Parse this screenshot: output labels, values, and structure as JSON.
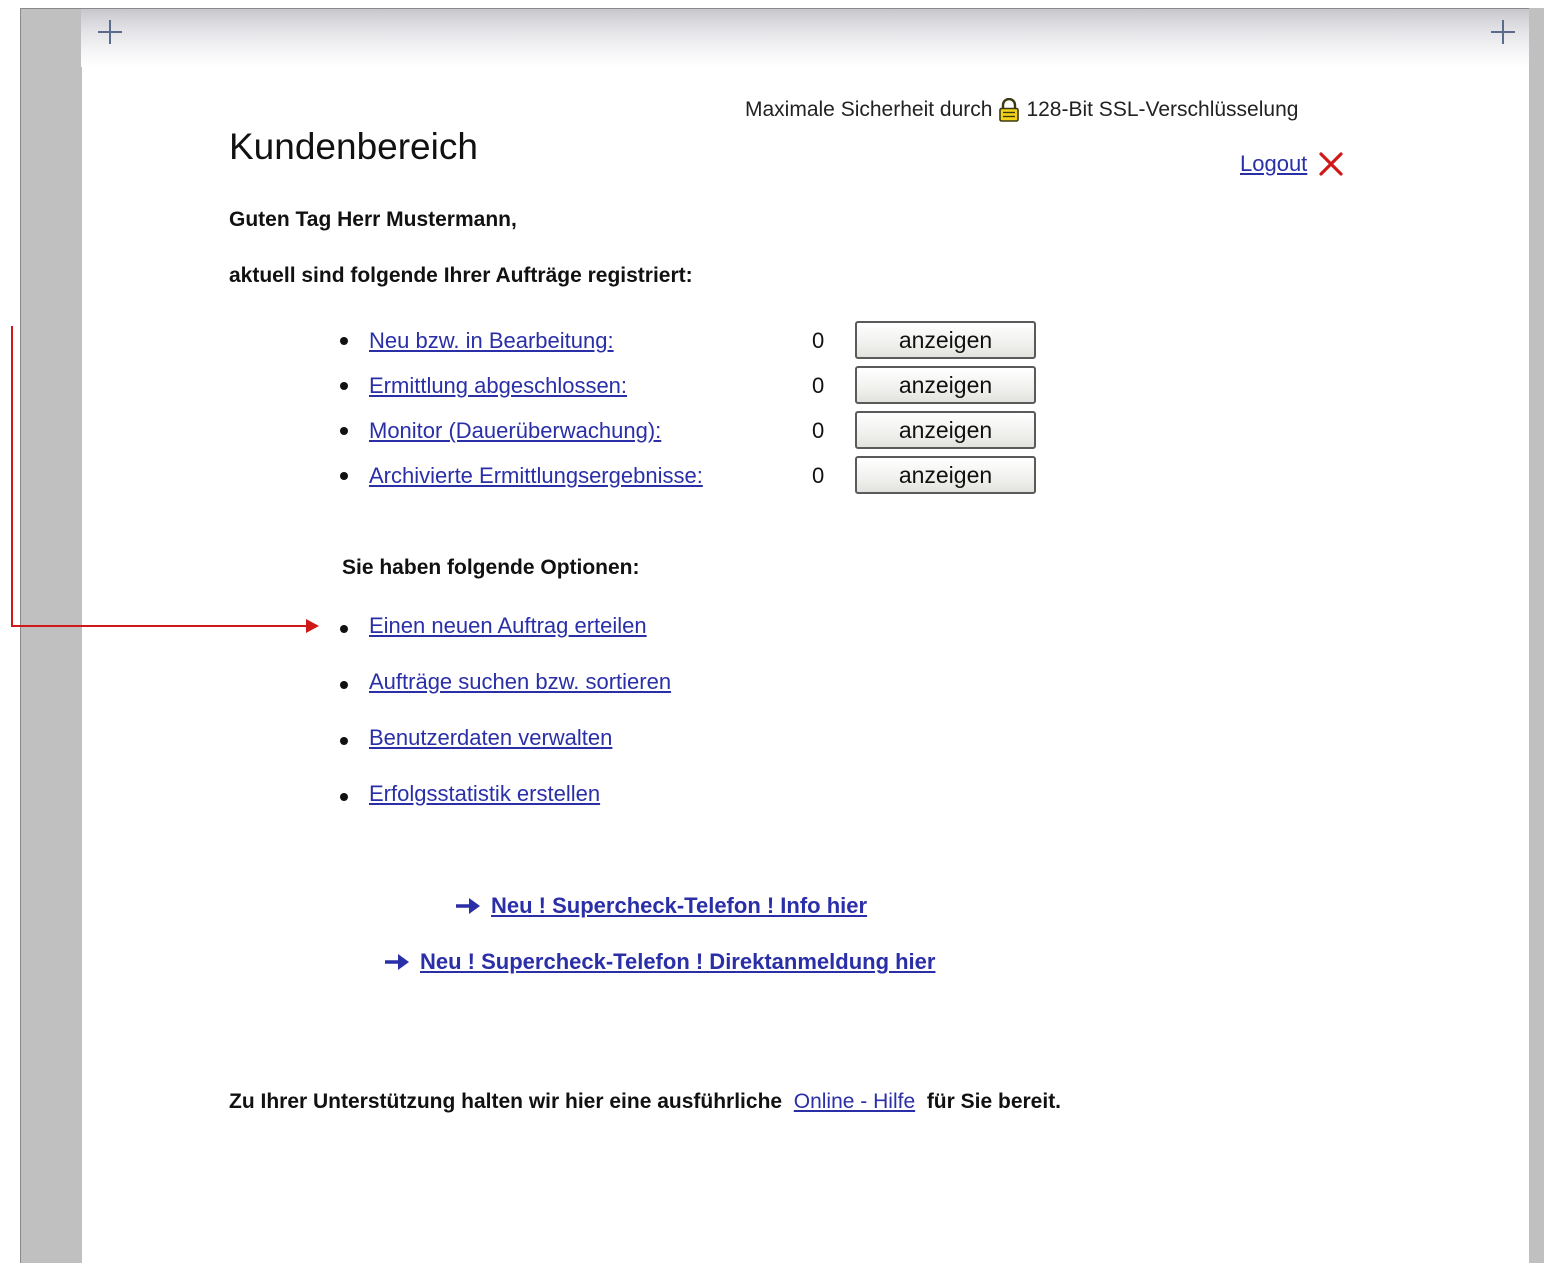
{
  "header": {
    "security_text_before": "Maximale Sicherheit durch",
    "security_text_after": "128-Bit SSL-Verschlüsselung",
    "logout_label": "Logout"
  },
  "page": {
    "title": "Kundenbereich",
    "greeting": "Guten Tag Herr Mustermann,",
    "orders_intro": "aktuell sind folgende Ihrer Aufträge registriert:"
  },
  "orders": [
    {
      "label": "Neu bzw. in Bearbeitung:",
      "count": "0",
      "button": "anzeigen"
    },
    {
      "label": "Ermittlung abgeschlossen:",
      "count": "0",
      "button": "anzeigen"
    },
    {
      "label": "Monitor (Dauerüberwachung):",
      "count": "0",
      "button": "anzeigen"
    },
    {
      "label": "Archivierte Ermittlungsergebnisse:",
      "count": "0",
      "button": "anzeigen"
    }
  ],
  "options": {
    "heading": "Sie haben folgende Optionen:",
    "items": [
      "Einen neuen Auftrag erteilen",
      "Aufträge suchen bzw. sortieren",
      "Benutzerdaten verwalten",
      "Erfolgsstatistik erstellen"
    ]
  },
  "promos": [
    "Neu ! Supercheck-Telefon ! Info hier",
    "Neu ! Supercheck-Telefon ! Direktanmeldung hier"
  ],
  "help": {
    "text_before": "Zu Ihrer Unterstützung halten wir hier eine ausführliche",
    "link": "Online - Hilfe",
    "text_after": "für Sie bereit."
  },
  "icons": {
    "lock": "lock-icon",
    "logout": "close-x-icon",
    "promo_arrow": "arrow-right-icon"
  },
  "colors": {
    "link": "#2a2fa8",
    "annotation": "#d01818",
    "logout_x": "#d01818",
    "frame": "#c0c0c0"
  }
}
